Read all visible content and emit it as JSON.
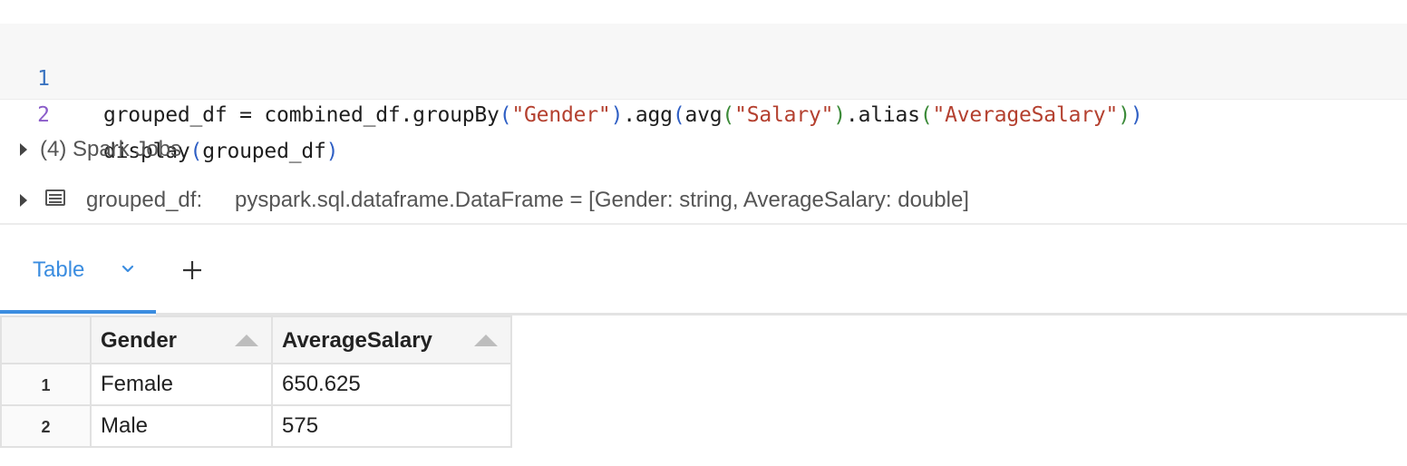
{
  "code": {
    "lines": [
      {
        "number": "1",
        "tokens": {
          "t1": "grouped_df = combined_df.groupBy",
          "t2": "(",
          "t3": "\"Gender\"",
          "t4": ")",
          "t5": ".agg",
          "t6": "(",
          "t7": "avg",
          "t8": "(",
          "t9": "\"Salary\"",
          "t10": ")",
          "t11": ".alias",
          "t12": "(",
          "t13": "\"AverageSalary\"",
          "t14": ")",
          "t15": ")"
        }
      },
      {
        "number": "2",
        "tokens": {
          "t1": "display",
          "t2": "(",
          "t3": "grouped_df",
          "t4": ")"
        }
      }
    ]
  },
  "output": {
    "spark_jobs_label": "(4) Spark Jobs",
    "schema_name": "grouped_df:",
    "schema_type": "pyspark.sql.dataframe.DataFrame = [Gender: string, AverageSalary: double]"
  },
  "tabs": {
    "active_label": "Table",
    "add_icon": "plus-icon",
    "chevron_icon": "chevron-down-icon"
  },
  "table": {
    "columns": [
      "Gender",
      "AverageSalary"
    ],
    "rows": [
      {
        "index": "1",
        "Gender": "Female",
        "AverageSalary": "650.625"
      },
      {
        "index": "2",
        "Gender": "Male",
        "AverageSalary": "575"
      }
    ]
  },
  "colors": {
    "accent": "#3b8de0",
    "string_literal": "#b4402f",
    "code_background": "#f7f7f7"
  }
}
